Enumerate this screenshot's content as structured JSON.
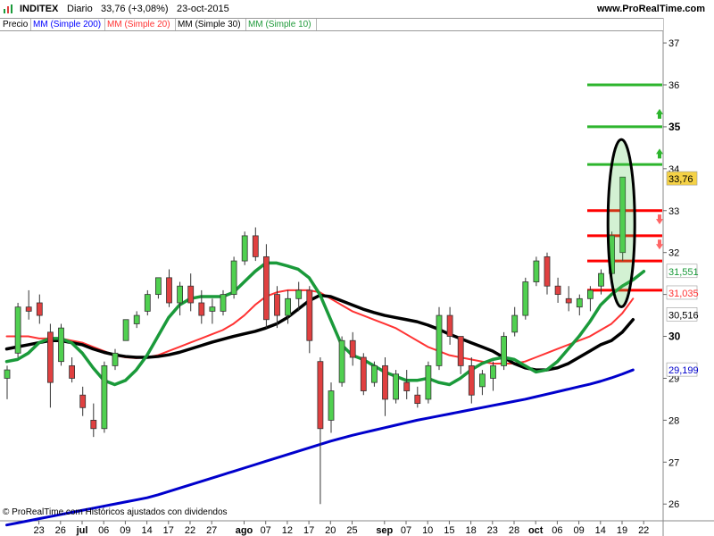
{
  "header": {
    "symbol": "INDITEX",
    "period": "Diario",
    "price_change": "33,76 (+3,08%)",
    "date": "23-oct-2015",
    "website": "www.ProRealTime.com"
  },
  "legend": {
    "price": "Precio",
    "items": [
      {
        "label": "MM (Simple 200)",
        "color": "#0000ff"
      },
      {
        "label": "MM (Simple 20)",
        "color": "#ff3333"
      },
      {
        "label": "MM (Simple 30)",
        "color": "#000000"
      },
      {
        "label": "MM (Simple 10)",
        "color": "#1f9a3a"
      }
    ]
  },
  "footer": {
    "copyright": "© ProRealTime.com  Históricos ajustados con dividendos"
  },
  "colors": {
    "up": "#50d050",
    "down": "#e04040",
    "wick": "#333333",
    "sma200": "#0000cc",
    "sma20": "#ff3333",
    "sma30": "#000000",
    "sma10": "#1a9a3a",
    "support": "#ff0000",
    "resistance": "#2db52d"
  },
  "chart_data": {
    "type": "candlestick",
    "ylim": [
      25.6,
      37.3
    ],
    "y_ticks": [
      26,
      27,
      28,
      29,
      30,
      31,
      32,
      33,
      34,
      35,
      36,
      37
    ],
    "y_ticks_bold": [
      30,
      35
    ],
    "x_labels": [
      {
        "i": 1,
        "text": "23"
      },
      {
        "i": 3,
        "text": "26"
      },
      {
        "i": 5,
        "text": "jul",
        "bold": true
      },
      {
        "i": 7,
        "text": "06"
      },
      {
        "i": 9,
        "text": "09"
      },
      {
        "i": 11,
        "text": "14"
      },
      {
        "i": 13,
        "text": "17"
      },
      {
        "i": 15,
        "text": "22"
      },
      {
        "i": 17,
        "text": "27"
      },
      {
        "i": 20,
        "text": "ago",
        "bold": true
      },
      {
        "i": 22,
        "text": "07"
      },
      {
        "i": 24,
        "text": "12"
      },
      {
        "i": 26,
        "text": "17"
      },
      {
        "i": 28,
        "text": "20"
      },
      {
        "i": 30,
        "text": "25"
      },
      {
        "i": 33,
        "text": "sep",
        "bold": true
      },
      {
        "i": 35,
        "text": "07"
      },
      {
        "i": 37,
        "text": "10"
      },
      {
        "i": 39,
        "text": "15"
      },
      {
        "i": 41,
        "text": "18"
      },
      {
        "i": 43,
        "text": "23"
      },
      {
        "i": 45,
        "text": "28"
      },
      {
        "i": 47,
        "text": "oct",
        "bold": true
      },
      {
        "i": 49,
        "text": "06"
      },
      {
        "i": 51,
        "text": "09"
      },
      {
        "i": 53,
        "text": "14"
      },
      {
        "i": 55,
        "text": "19"
      },
      {
        "i": 57,
        "text": "22"
      }
    ],
    "candles": [
      [
        29.0,
        29.3,
        28.5,
        29.2
      ],
      [
        29.6,
        30.8,
        29.5,
        30.7
      ],
      [
        30.7,
        31.1,
        30.4,
        30.6
      ],
      [
        30.8,
        31.0,
        30.3,
        30.5
      ],
      [
        30.1,
        30.3,
        28.3,
        28.9
      ],
      [
        29.4,
        30.3,
        29.3,
        30.2
      ],
      [
        29.3,
        29.5,
        28.9,
        29.0
      ],
      [
        28.6,
        28.8,
        28.1,
        28.3
      ],
      [
        28.0,
        28.4,
        27.6,
        27.8
      ],
      [
        27.8,
        29.4,
        27.7,
        29.3
      ],
      [
        29.3,
        29.7,
        29.2,
        29.6
      ],
      [
        29.9,
        30.4,
        29.9,
        30.4
      ],
      [
        30.3,
        30.6,
        30.2,
        30.5
      ],
      [
        30.6,
        31.1,
        30.5,
        31.0
      ],
      [
        31.0,
        31.4,
        30.9,
        31.4
      ],
      [
        31.4,
        31.6,
        30.7,
        30.8
      ],
      [
        30.8,
        31.3,
        30.5,
        31.2
      ],
      [
        31.2,
        31.5,
        30.6,
        30.8
      ],
      [
        30.8,
        31.1,
        30.3,
        30.5
      ],
      [
        30.6,
        30.9,
        30.3,
        30.7
      ],
      [
        30.6,
        31.1,
        30.5,
        31.0
      ],
      [
        31.0,
        31.9,
        30.9,
        31.8
      ],
      [
        31.8,
        32.5,
        31.7,
        32.4
      ],
      [
        32.4,
        32.6,
        31.8,
        31.9
      ],
      [
        31.9,
        32.2,
        30.2,
        30.4
      ],
      [
        31.0,
        31.2,
        30.2,
        30.5
      ],
      [
        30.5,
        31.1,
        30.3,
        30.9
      ],
      [
        30.9,
        31.3,
        30.6,
        31.1
      ],
      [
        31.1,
        31.2,
        29.6,
        29.9
      ],
      [
        29.4,
        29.5,
        26.0,
        27.8
      ],
      [
        28.0,
        28.9,
        27.7,
        28.7
      ],
      [
        28.9,
        30.0,
        28.8,
        29.9
      ],
      [
        29.9,
        30.1,
        29.3,
        29.5
      ],
      [
        29.5,
        29.6,
        28.6,
        28.7
      ],
      [
        28.9,
        29.4,
        28.8,
        29.3
      ],
      [
        29.3,
        29.5,
        28.1,
        28.5
      ],
      [
        28.5,
        29.2,
        28.4,
        29.1
      ],
      [
        28.9,
        29.2,
        28.5,
        28.7
      ],
      [
        28.6,
        28.8,
        28.3,
        28.4
      ],
      [
        28.5,
        29.4,
        28.4,
        29.3
      ],
      [
        29.3,
        30.7,
        29.2,
        30.5
      ],
      [
        30.5,
        30.7,
        29.8,
        30.0
      ],
      [
        30.0,
        30.0,
        29.1,
        29.3
      ],
      [
        29.3,
        29.5,
        28.4,
        28.6
      ],
      [
        28.8,
        29.2,
        28.6,
        29.1
      ],
      [
        29.0,
        29.4,
        28.7,
        29.3
      ],
      [
        29.3,
        30.1,
        29.2,
        30.0
      ],
      [
        30.1,
        30.7,
        30.0,
        30.5
      ],
      [
        30.5,
        31.4,
        30.4,
        31.3
      ],
      [
        31.3,
        31.9,
        31.2,
        31.8
      ],
      [
        31.9,
        32.0,
        31.0,
        31.2
      ],
      [
        31.2,
        31.4,
        30.8,
        31.0
      ],
      [
        30.9,
        31.2,
        30.6,
        30.8
      ],
      [
        30.7,
        31.0,
        30.5,
        30.9
      ],
      [
        30.9,
        31.2,
        30.6,
        31.1
      ],
      [
        31.2,
        31.6,
        31.0,
        31.5
      ],
      [
        31.5,
        32.5,
        31.3,
        32.4
      ],
      [
        32.0,
        33.8,
        31.8,
        33.8
      ]
    ],
    "series": [
      {
        "name": "MM (Simple 200)",
        "values": [
          25.5,
          25.55,
          25.6,
          25.65,
          25.7,
          25.75,
          25.8,
          25.85,
          25.9,
          25.95,
          26.0,
          26.05,
          26.1,
          26.15,
          26.22,
          26.3,
          26.38,
          26.46,
          26.54,
          26.62,
          26.7,
          26.78,
          26.86,
          26.94,
          27.02,
          27.1,
          27.18,
          27.26,
          27.34,
          27.42,
          27.5,
          27.57,
          27.64,
          27.7,
          27.76,
          27.82,
          27.88,
          27.94,
          28.0,
          28.05,
          28.1,
          28.15,
          28.2,
          28.25,
          28.3,
          28.35,
          28.4,
          28.45,
          28.5,
          28.56,
          28.62,
          28.68,
          28.74,
          28.8,
          28.86,
          28.93,
          29.01,
          29.1,
          29.2
        ]
      },
      {
        "name": "MM (Simple 20)",
        "values": [
          30.0,
          30.0,
          30.0,
          29.95,
          29.95,
          29.95,
          29.9,
          29.85,
          29.75,
          29.65,
          29.55,
          29.5,
          29.48,
          29.5,
          29.55,
          29.65,
          29.75,
          29.85,
          29.95,
          30.05,
          30.15,
          30.3,
          30.5,
          30.75,
          30.95,
          31.05,
          31.1,
          31.1,
          31.1,
          31.05,
          30.9,
          30.75,
          30.6,
          30.5,
          30.4,
          30.3,
          30.2,
          30.05,
          29.9,
          29.75,
          29.65,
          29.55,
          29.5,
          29.45,
          29.4,
          29.35,
          29.35,
          29.35,
          29.4,
          29.5,
          29.6,
          29.7,
          29.8,
          29.9,
          30.0,
          30.15,
          30.3,
          30.55,
          30.9
        ]
      },
      {
        "name": "MM (Simple 30)",
        "values": [
          29.7,
          29.75,
          29.8,
          29.85,
          29.9,
          29.9,
          29.85,
          29.8,
          29.7,
          29.62,
          29.56,
          29.52,
          29.5,
          29.5,
          29.52,
          29.56,
          29.62,
          29.7,
          29.78,
          29.86,
          29.93,
          30.0,
          30.06,
          30.12,
          30.2,
          30.3,
          30.45,
          30.65,
          30.85,
          30.98,
          30.95,
          30.85,
          30.75,
          30.65,
          30.57,
          30.5,
          30.45,
          30.4,
          30.35,
          30.27,
          30.17,
          30.05,
          29.95,
          29.85,
          29.75,
          29.65,
          29.5,
          29.35,
          29.25,
          29.2,
          29.2,
          29.25,
          29.35,
          29.5,
          29.65,
          29.8,
          29.9,
          30.1,
          30.4
        ]
      },
      {
        "name": "MM (Simple 10)",
        "values": [
          29.4,
          29.45,
          29.6,
          29.85,
          29.95,
          29.95,
          29.85,
          29.6,
          29.25,
          28.95,
          28.85,
          28.95,
          29.2,
          29.55,
          30.0,
          30.45,
          30.75,
          30.9,
          30.95,
          30.95,
          30.95,
          31.05,
          31.3,
          31.55,
          31.75,
          31.75,
          31.68,
          31.6,
          31.4,
          31.0,
          30.4,
          29.8,
          29.55,
          29.45,
          29.3,
          29.15,
          29.05,
          28.95,
          28.95,
          29.0,
          28.9,
          28.85,
          29.0,
          29.2,
          29.35,
          29.45,
          29.5,
          29.45,
          29.3,
          29.15,
          29.2,
          29.4,
          29.7,
          30.0,
          30.35,
          30.75,
          31.0,
          31.2,
          31.35,
          31.551
        ]
      }
    ],
    "horizontal_lines": [
      {
        "y": 36.0,
        "kind": "resistance"
      },
      {
        "y": 35.0,
        "kind": "resistance"
      },
      {
        "y": 34.1,
        "kind": "resistance"
      },
      {
        "y": 33.0,
        "kind": "support"
      },
      {
        "y": 32.4,
        "kind": "support"
      },
      {
        "y": 31.8,
        "kind": "support"
      },
      {
        "y": 31.1,
        "kind": "support"
      }
    ],
    "value_labels": [
      {
        "text": "33,76",
        "y": 33.76,
        "bg": "#f5d246",
        "fg": "#000000"
      },
      {
        "text": "31,551",
        "y": 31.551,
        "bg": "#ffffff",
        "fg": "#1a9a3a"
      },
      {
        "text": "31,035",
        "y": 31.035,
        "bg": "#ffffff",
        "fg": "#ff3333"
      },
      {
        "text": "30,516",
        "y": 30.516,
        "bg": "#ffffff",
        "fg": "#000000"
      },
      {
        "text": "29,199",
        "y": 29.199,
        "bg": "#ffffff",
        "fg": "#0000cc"
      }
    ]
  }
}
